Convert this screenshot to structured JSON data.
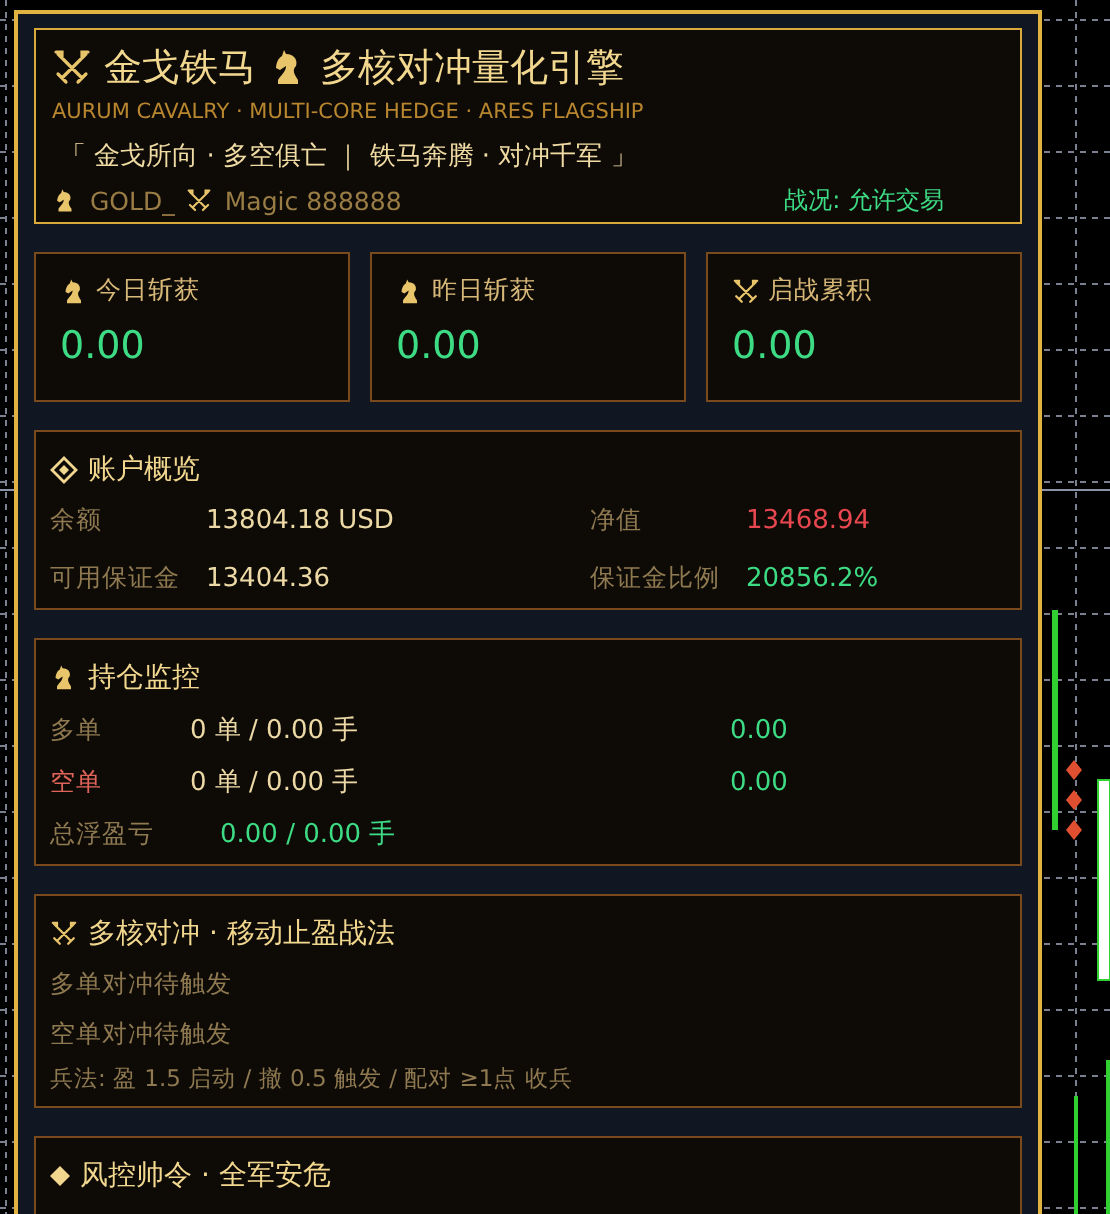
{
  "header": {
    "title": "金戈铁马",
    "engine": "多核对冲量化引擎",
    "subtitle": "AURUM CAVALRY · MULTI-CORE HEDGE · ARES FLAGSHIP",
    "motto": "「 金戈所向 · 多空俱亡 ｜ 铁马奔腾 · 对冲千军 」",
    "symbol": "GOLD_",
    "magic": "Magic 888888",
    "status": "战况: 允许交易"
  },
  "stats": [
    {
      "label": "今日斩获",
      "value": "0.00"
    },
    {
      "label": "昨日斩获",
      "value": "0.00"
    },
    {
      "label": "启战累积",
      "value": "0.00"
    }
  ],
  "account": {
    "title": "账户概览",
    "fields": [
      {
        "label": "余额",
        "value": "13804.18 USD",
        "color": "#ecd9a6"
      },
      {
        "label": "净值",
        "value": "13468.94",
        "color": "#e8474f"
      },
      {
        "label": "可用保证金",
        "value": "13404.36",
        "color": "#ecd9a6"
      },
      {
        "label": "保证金比例",
        "value": "20856.2%",
        "color": "#3ddc84"
      }
    ]
  },
  "positions": {
    "title": "持仓监控",
    "rows": [
      {
        "kind": "long",
        "label": "多单",
        "orders": "0 单 / 0.00 手",
        "profit": "0.00"
      },
      {
        "kind": "short",
        "label": "空单",
        "orders": "0 单 / 0.00 手",
        "profit": "0.00"
      },
      {
        "kind": "total",
        "label": "总浮盈亏",
        "orders": "0.00  /  0.00 手"
      }
    ]
  },
  "strategy": {
    "title": "多核对冲 · 移动止盈战法",
    "lines": [
      "多单对冲待触发",
      "空单对冲待触发"
    ],
    "rule": "兵法: 盈 1.5 启动 / 撤 0.5 触发 / 配对 ≥1点 收兵"
  },
  "risk": {
    "title": "风控帅令 · 全军安危"
  }
}
